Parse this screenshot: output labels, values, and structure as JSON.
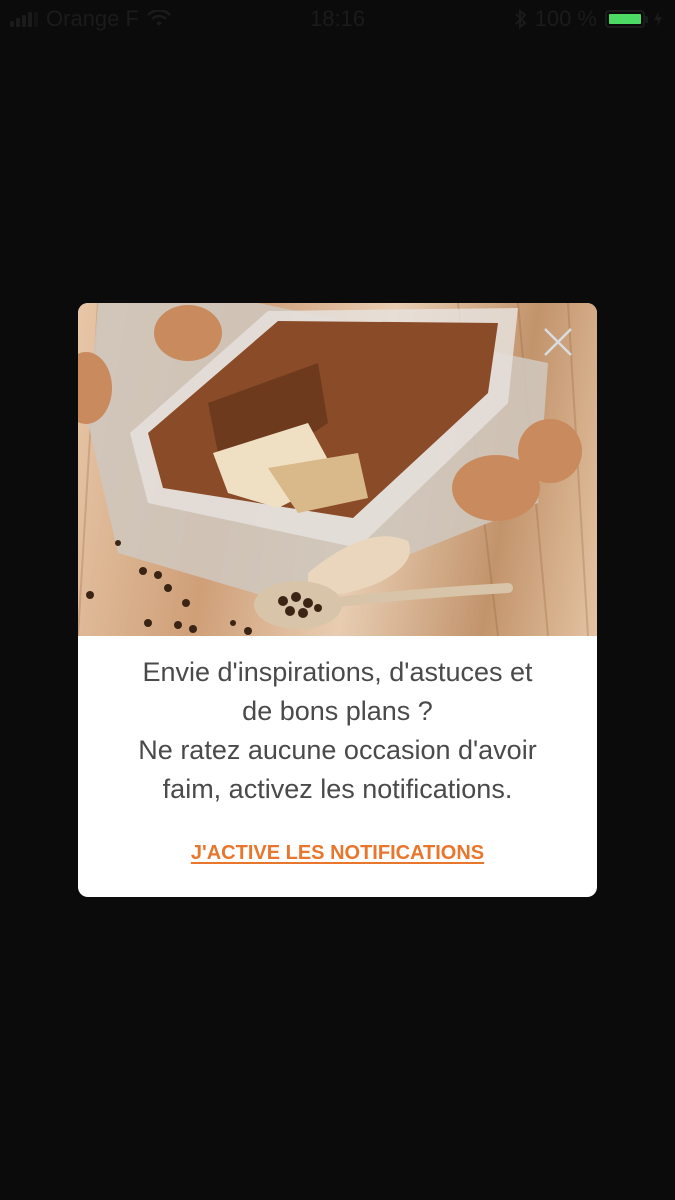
{
  "status_bar": {
    "carrier": "Orange F",
    "time": "18:16",
    "battery": "100 %",
    "battery_level": 1.0,
    "icons": [
      "signal-icon",
      "wifi-icon",
      "bluetooth-icon",
      "battery-icon",
      "charging-icon"
    ]
  },
  "modal": {
    "image_icon": "tiramisu-photo",
    "close_icon": "close-icon",
    "message_lines": [
      "Envie d'inspirations, d'astuces et",
      "de bons plans ?",
      "Ne ratez aucune occasion d'avoir",
      "faim, activez les notifications."
    ],
    "cta_label": "J'ACTIVE LES NOTIFICATIONS"
  },
  "colors": {
    "background": "#0b0b0b",
    "modal": "#ffffff",
    "text": "#4a4a4a",
    "accent": "#e8762d",
    "battery": "#4cd964"
  }
}
